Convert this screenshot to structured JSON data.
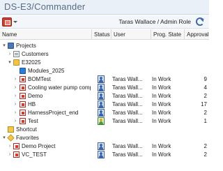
{
  "window": {
    "title": "DS-E3/Commander"
  },
  "toolbar": {
    "user_role": "Taras Wallace / Admin Role"
  },
  "columns": [
    {
      "label": "Name"
    },
    {
      "label": "Status"
    },
    {
      "label": "User"
    },
    {
      "label": "Prog. State"
    },
    {
      "label": "Approval Ver."
    }
  ],
  "rows": [
    {
      "label": "Projects",
      "expanded": true,
      "icon": "projects-icon",
      "user": "",
      "state": "",
      "approval": ""
    },
    {
      "label": "Customers",
      "expanded": false,
      "icon": "customers-icon",
      "user": "",
      "state": "",
      "approval": ""
    },
    {
      "label": "E32025",
      "expanded": true,
      "icon": "folder-open-icon",
      "user": "",
      "state": "",
      "approval": ""
    },
    {
      "label": "Modules_2025",
      "expanded": false,
      "icon": "folder-icon",
      "user": "",
      "state": "",
      "approval": ""
    },
    {
      "label": "BOMTest",
      "expanded": false,
      "icon": "project-icon",
      "status": "user-status-icon",
      "user": "Taras Wall...",
      "state": "In Work",
      "approval": "9"
    },
    {
      "label": "Cooling water pump comp...",
      "expanded": false,
      "icon": "project-icon",
      "status": "user-status-icon",
      "user": "Taras Wall...",
      "state": "In Work",
      "approval": "4"
    },
    {
      "label": "Demo",
      "expanded": false,
      "icon": "project-icon",
      "status": "user-status-icon",
      "user": "Taras Wall...",
      "state": "In Work",
      "approval": "2"
    },
    {
      "label": "HB",
      "expanded": false,
      "icon": "project-icon",
      "status": "user-status-icon",
      "user": "Taras Wall...",
      "state": "In Work",
      "approval": "17"
    },
    {
      "label": "HarnessProject_end",
      "expanded": false,
      "icon": "project-icon",
      "status": "user-status-icon",
      "user": "Taras Wall...",
      "state": "In Work",
      "approval": "2"
    },
    {
      "label": "Test",
      "expanded": false,
      "icon": "project-icon",
      "status": "locked-status-icon",
      "user": "Taras Wall...",
      "state": "In Work",
      "approval": "1"
    },
    {
      "label": "Shortcut",
      "expanded": false,
      "icon": "shortcut-icon",
      "user": "",
      "state": "",
      "approval": ""
    },
    {
      "label": "Favorites",
      "expanded": true,
      "icon": "favorites-icon",
      "user": "",
      "state": "",
      "approval": ""
    },
    {
      "label": "Demo Project",
      "expanded": false,
      "icon": "project-icon",
      "status": "user-status-icon",
      "user": "Taras Wall...",
      "state": "In Work",
      "approval": "2"
    },
    {
      "label": "VC_TEST",
      "expanded": false,
      "icon": "project-icon",
      "status": "user-status-icon",
      "user": "Taras Wall...",
      "state": "In Work",
      "approval": "2"
    }
  ],
  "colors": {
    "title_text": "#5a6c82",
    "app_button": "#d13b2e",
    "refresh_icon": "#3b6aa8"
  }
}
